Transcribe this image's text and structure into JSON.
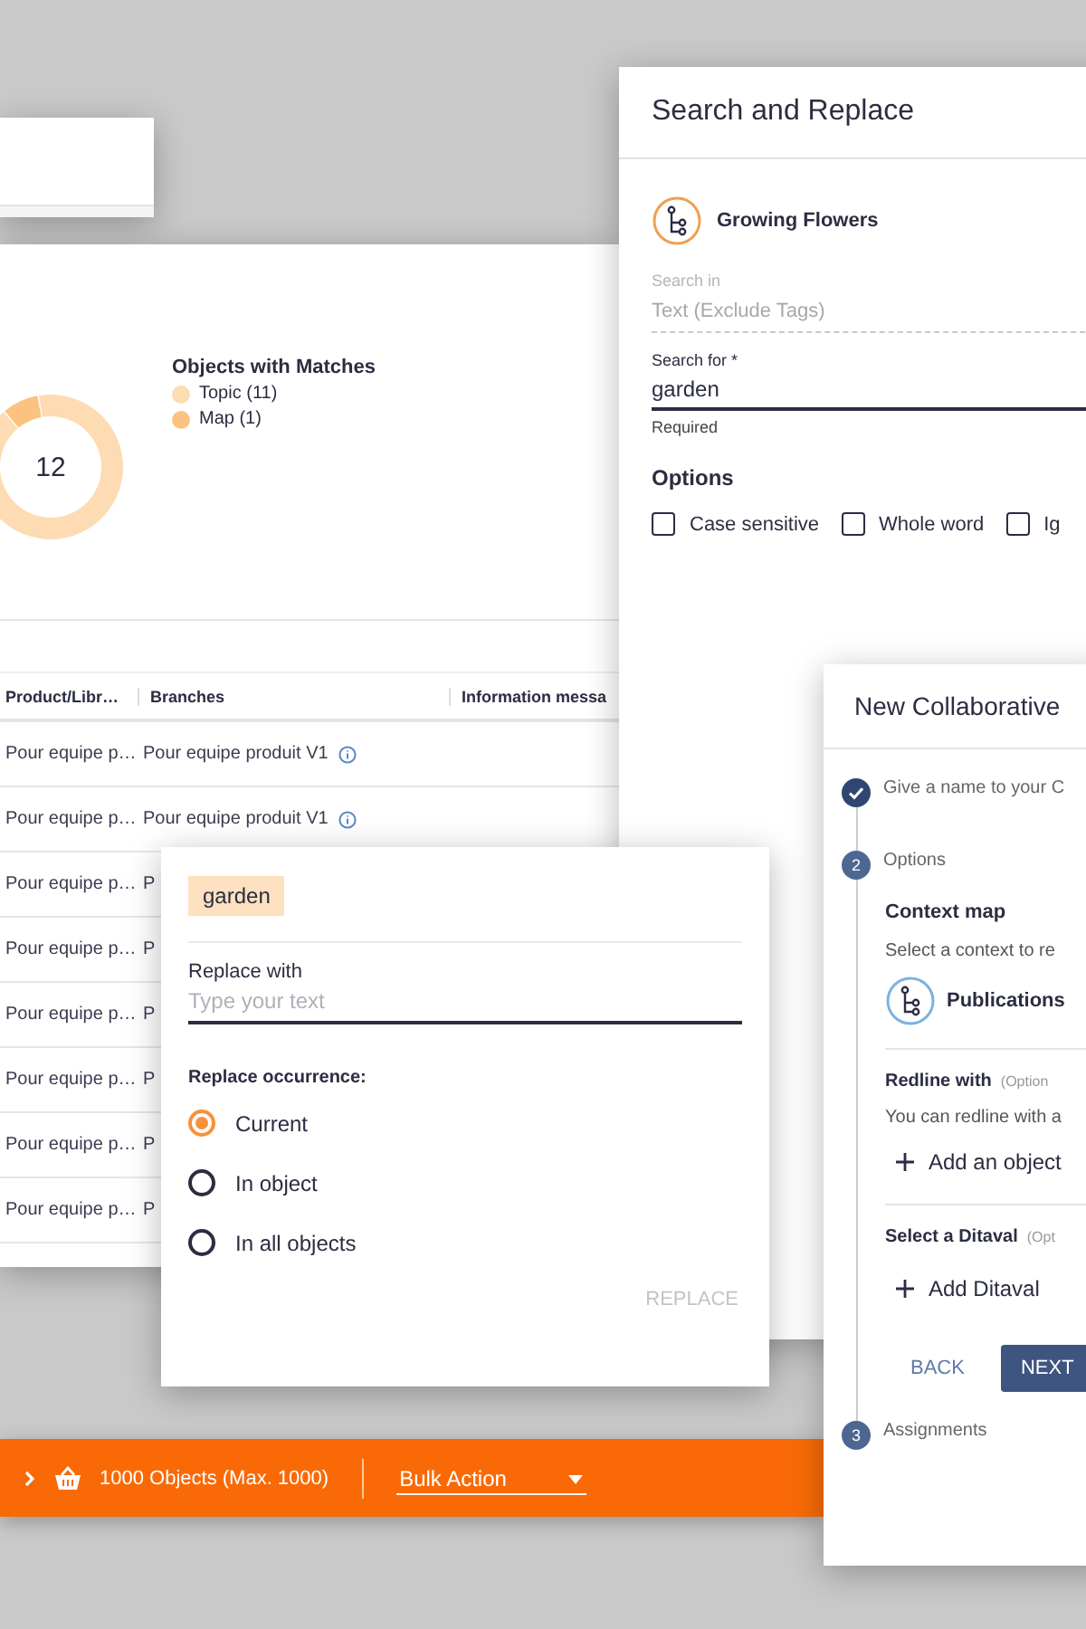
{
  "results": {
    "chart": {
      "center_label": "12",
      "chart_data": {
        "type": "donut",
        "title": "Objects with Matches",
        "categories": [
          "Topic (11)",
          "Map (1)"
        ],
        "values": [
          11,
          1
        ],
        "legend": "right"
      }
    },
    "table": {
      "columns": [
        "Product/Libr…",
        "Branches",
        "Information messa"
      ],
      "rows": [
        {
          "cells": [
            "Pour equipe p…",
            "Pour equipe produit V1"
          ],
          "info_icon": true
        },
        {
          "cells": [
            "Pour equipe p…",
            "Pour equipe produit V1"
          ],
          "info_icon": true
        },
        {
          "cells": [
            "Pour equipe p…",
            "P"
          ],
          "info_icon": false
        },
        {
          "cells": [
            "Pour equipe p…",
            "P"
          ],
          "info_icon": false
        },
        {
          "cells": [
            "Pour equipe p…",
            "P"
          ],
          "info_icon": false
        },
        {
          "cells": [
            "Pour equipe p…",
            "P"
          ],
          "info_icon": false
        },
        {
          "cells": [
            "Pour equipe p…",
            "P"
          ],
          "info_icon": false
        },
        {
          "cells": [
            "Pour equipe p…",
            "P"
          ],
          "info_icon": false
        }
      ]
    }
  },
  "search_dialog": {
    "title": "Search and Replace",
    "object": "Growing Flowers",
    "search_in": {
      "label": "Search in",
      "value": "Text (Exclude Tags)"
    },
    "search_for": {
      "label": "Search for *",
      "value": "garden",
      "helper": "Required"
    },
    "options": {
      "title": "Options",
      "items": [
        {
          "label": "Case sensitive",
          "checked": false
        },
        {
          "label": "Whole word",
          "checked": false
        },
        {
          "label": "Ig",
          "checked": false
        }
      ]
    }
  },
  "replace_popup": {
    "match": "garden",
    "replace": {
      "label": "Replace with",
      "placeholder": "Type your text"
    },
    "occurrence": {
      "title": "Replace occurrence:",
      "items": [
        {
          "label": "Current",
          "selected": true
        },
        {
          "label": "In object",
          "selected": false
        },
        {
          "label": "In all objects",
          "selected": false
        }
      ]
    },
    "button": {
      "label": "REPLACE",
      "disabled": true
    }
  },
  "collab_dialog": {
    "title": "New Collaborative",
    "steps": [
      {
        "label": "Give a name to your C",
        "completed": true
      },
      {
        "number": "2",
        "label": "Options",
        "completed": false
      },
      {
        "number": "3",
        "label": "Assignments",
        "completed": false
      }
    ],
    "context": {
      "title": "Context map",
      "text": "Select a context to re",
      "object": "Publications"
    },
    "redline": {
      "title": "Redline with",
      "note": "(Option",
      "text": "You can redline with a",
      "add": "Add an object"
    },
    "ditaval": {
      "title": "Select a Ditaval",
      "note": "(Opt",
      "add": "Add Ditaval"
    },
    "buttons": {
      "back": "BACK",
      "next": "NEXT"
    }
  },
  "bulk_bar": {
    "count": "1000 Objects (Max. 1000)",
    "action": "Bulk Action"
  }
}
